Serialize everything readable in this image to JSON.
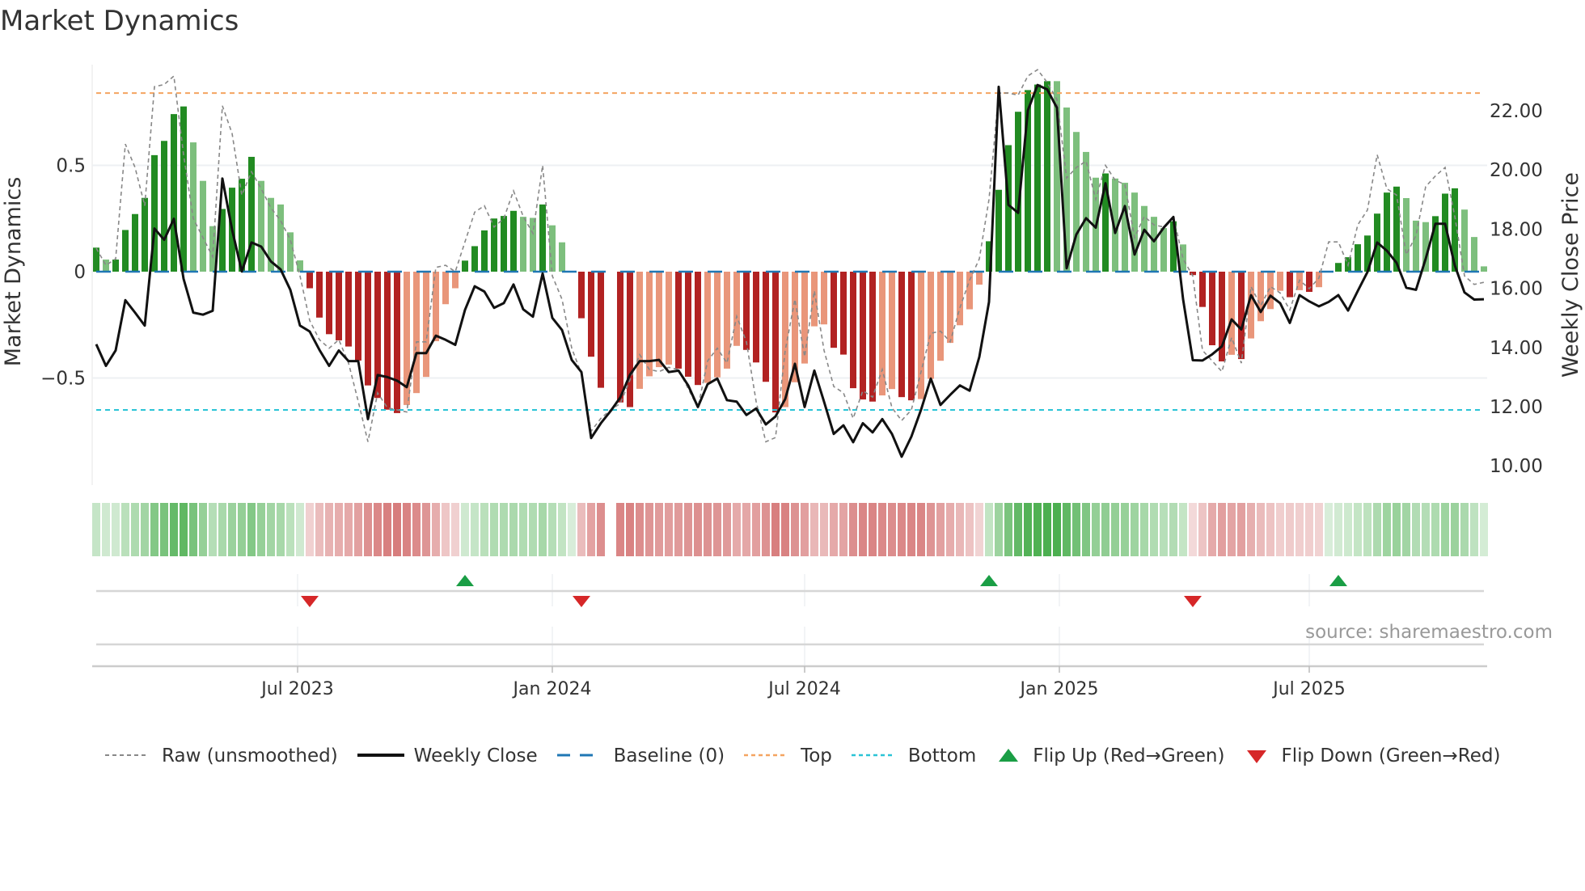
{
  "title": "Market Dynamics",
  "source": "source: sharemaestro.com",
  "chart_data": {
    "type": "bar",
    "title": "Market Dynamics",
    "ylabel_left": "Market Dynamics",
    "ylabel_right": "Weekly Close Price",
    "ylim_left": [
      -0.98,
      0.98
    ],
    "ylim_right": [
      10.0,
      23.6
    ],
    "left_ticks": [
      {
        "v": 0.5,
        "label": "0.5"
      },
      {
        "v": 0,
        "label": "0"
      },
      {
        "v": -0.5,
        "label": "−0.5"
      }
    ],
    "right_ticks": [
      {
        "v": 22,
        "label": "22.00"
      },
      {
        "v": 20,
        "label": "20.00"
      },
      {
        "v": 18,
        "label": "18.00"
      },
      {
        "v": 16,
        "label": "16.00"
      },
      {
        "v": 14,
        "label": "14.00"
      },
      {
        "v": 12,
        "label": "12.00"
      },
      {
        "v": 10,
        "label": "10.00"
      }
    ],
    "x_ticks": [
      {
        "week": 20.75,
        "label": "Jul 2023"
      },
      {
        "week": 47,
        "label": "Jan 2024"
      },
      {
        "week": 73,
        "label": "Jul 2024"
      },
      {
        "week": 99.25,
        "label": "Jan 2025"
      },
      {
        "week": 125,
        "label": "Jul 2025"
      }
    ],
    "top_level": 0.84,
    "bottom_level": -0.65,
    "baseline": 0,
    "bars": [
      0.113,
      0.057,
      0.057,
      0.196,
      0.271,
      0.347,
      0.548,
      0.615,
      0.741,
      0.777,
      0.608,
      0.427,
      0.214,
      0.295,
      0.395,
      0.437,
      0.54,
      0.427,
      0.347,
      0.316,
      0.185,
      0.053,
      -0.078,
      -0.216,
      -0.294,
      -0.323,
      -0.352,
      -0.418,
      -0.535,
      -0.594,
      -0.649,
      -0.665,
      -0.627,
      -0.571,
      -0.495,
      -0.327,
      -0.153,
      -0.078,
      0.052,
      0.12,
      0.194,
      0.25,
      0.262,
      0.286,
      0.258,
      0.253,
      0.316,
      0.218,
      0.138,
      0,
      -0.219,
      -0.4,
      -0.546,
      null,
      -0.615,
      -0.637,
      -0.551,
      -0.492,
      -0.449,
      -0.437,
      -0.456,
      -0.494,
      -0.533,
      -0.523,
      -0.497,
      -0.456,
      -0.349,
      -0.368,
      -0.427,
      -0.518,
      -0.662,
      -0.637,
      -0.52,
      -0.432,
      -0.257,
      -0.248,
      -0.358,
      -0.39,
      -0.548,
      -0.601,
      -0.611,
      -0.582,
      -0.552,
      -0.59,
      -0.605,
      -0.599,
      -0.504,
      -0.419,
      -0.335,
      -0.252,
      -0.177,
      -0.061,
      0.143,
      0.385,
      0.595,
      0.752,
      0.854,
      0.88,
      0.896,
      0.896,
      0.772,
      0.657,
      0.563,
      0.442,
      0.462,
      0.438,
      0.418,
      0.372,
      0.309,
      0.258,
      0.205,
      0.237,
      0.128,
      -0.016,
      -0.166,
      -0.346,
      -0.422,
      -0.391,
      -0.411,
      -0.314,
      -0.233,
      -0.176,
      -0.09,
      -0.12,
      -0.087,
      -0.095,
      -0.073,
      0,
      0.041,
      0.068,
      0.129,
      0.17,
      0.273,
      0.372,
      0.4,
      0.346,
      0.24,
      0.233,
      0.261,
      0.367,
      0.392,
      0.292,
      0.163,
      0.025
    ],
    "bar_strong": [
      1,
      0,
      1,
      1,
      1,
      1,
      1,
      1,
      1,
      1,
      0,
      0,
      0,
      1,
      1,
      1,
      1,
      0,
      0,
      0,
      0,
      0,
      1,
      1,
      1,
      1,
      1,
      1,
      1,
      1,
      1,
      1,
      0,
      0,
      0,
      0,
      0,
      0,
      1,
      1,
      1,
      1,
      1,
      1,
      0,
      0,
      1,
      0,
      0,
      0,
      1,
      1,
      1,
      0,
      1,
      1,
      0,
      0,
      0,
      0,
      1,
      1,
      1,
      0,
      0,
      0,
      0,
      1,
      1,
      1,
      1,
      0,
      0,
      0,
      0,
      0,
      1,
      1,
      1,
      1,
      1,
      0,
      0,
      1,
      1,
      0,
      0,
      0,
      0,
      0,
      0,
      0,
      1,
      1,
      1,
      1,
      1,
      1,
      1,
      0,
      0,
      0,
      0,
      0,
      1,
      0,
      0,
      0,
      0,
      0,
      0,
      1,
      0,
      1,
      1,
      1,
      1,
      0,
      1,
      0,
      0,
      0,
      0,
      1,
      0,
      1,
      0,
      0,
      1,
      1,
      1,
      1,
      1,
      1,
      1,
      0,
      0,
      0,
      1,
      1,
      1,
      0,
      0,
      0
    ],
    "weekly_close": [
      14.11,
      13.38,
      13.9,
      15.6,
      15.18,
      14.74,
      18.02,
      17.64,
      18.35,
      16.32,
      15.18,
      15.11,
      15.24,
      19.71,
      17.98,
      16.57,
      17.55,
      17.41,
      16.91,
      16.64,
      15.95,
      14.74,
      14.54,
      13.92,
      13.38,
      13.9,
      13.54,
      13.54,
      11.58,
      13.07,
      13.0,
      12.88,
      12.66,
      13.81,
      13.81,
      14.4,
      14.26,
      14.09,
      15.27,
      16.07,
      15.89,
      15.34,
      15.5,
      16.13,
      15.29,
      15.04,
      16.5,
      15.0,
      14.59,
      13.58,
      13.17,
      10.94,
      11.44,
      11.85,
      12.31,
      13.08,
      13.54,
      13.54,
      13.58,
      13.17,
      13.22,
      12.72,
      11.99,
      12.76,
      12.95,
      12.22,
      12.17,
      11.72,
      11.94,
      11.4,
      11.67,
      12.26,
      13.45,
      11.99,
      13.22,
      12.17,
      11.08,
      11.37,
      10.8,
      11.44,
      11.13,
      11.58,
      11.08,
      10.31,
      10.99,
      11.9,
      12.95,
      12.06,
      12.4,
      12.72,
      12.54,
      13.68,
      15.54,
      22.81,
      18.82,
      18.55,
      22.01,
      22.87,
      22.72,
      22.1,
      16.68,
      17.82,
      18.37,
      18.05,
      19.55,
      17.87,
      18.78,
      17.14,
      17.98,
      17.59,
      18.05,
      18.41,
      15.63,
      13.57,
      13.56,
      13.77,
      14.04,
      14.95,
      14.61,
      15.77,
      15.2,
      15.75,
      15.5,
      14.83,
      15.77,
      15.56,
      15.39,
      15.54,
      15.77,
      15.25,
      15.91,
      16.55,
      17.55,
      17.27,
      16.86,
      16.02,
      15.95,
      17.0,
      18.18,
      18.18,
      16.77,
      15.86,
      15.62,
      15.63
    ],
    "raw": [
      0.11,
      0.03,
      0.06,
      0.6,
      0.49,
      0.31,
      0.87,
      0.88,
      0.92,
      0.55,
      0.25,
      0.16,
      0.07,
      0.78,
      0.65,
      0.36,
      0.47,
      0.39,
      0.3,
      0.24,
      0.15,
      -0.02,
      -0.23,
      -0.32,
      -0.36,
      -0.32,
      -0.43,
      -0.61,
      -0.8,
      -0.57,
      -0.64,
      -0.65,
      -0.66,
      -0.33,
      -0.33,
      0.02,
      0.03,
      0,
      0.14,
      0.28,
      0.31,
      0.21,
      0.25,
      0.38,
      0.26,
      0.18,
      0.5,
      -0.02,
      -0.13,
      -0.36,
      -0.48,
      -0.75,
      -0.69,
      -0.65,
      -0.62,
      -0.51,
      -0.39,
      -0.46,
      -0.47,
      -0.45,
      -0.46,
      -0.55,
      -0.64,
      -0.42,
      -0.36,
      -0.43,
      -0.21,
      -0.33,
      -0.61,
      -0.8,
      -0.78,
      -0.37,
      -0.13,
      -0.4,
      -0.09,
      -0.37,
      -0.54,
      -0.57,
      -0.69,
      -0.56,
      -0.59,
      -0.46,
      -0.64,
      -0.7,
      -0.65,
      -0.47,
      -0.29,
      -0.28,
      -0.33,
      -0.17,
      -0.04,
      0.06,
      0.34,
      0.84,
      0.84,
      0.83,
      0.92,
      0.95,
      0.89,
      0.81,
      0.44,
      0.49,
      0.52,
      0.34,
      0.5,
      0.43,
      0.41,
      0.16,
      0.26,
      0.22,
      0.21,
      0.26,
      0.06,
      -0.02,
      -0.37,
      -0.42,
      -0.47,
      -0.31,
      -0.43,
      -0.07,
      -0.16,
      -0.07,
      -0.1,
      -0.18,
      -0.04,
      -0.08,
      -0.03,
      0.14,
      0.14,
      0.03,
      0.22,
      0.29,
      0.55,
      0.39,
      0.36,
      0.08,
      0.17,
      0.4,
      0.45,
      0.49,
      0.26,
      -0.02,
      -0.06,
      -0.05
    ],
    "flips_up": [
      38,
      92,
      128
    ],
    "flips_down": [
      22,
      50,
      113
    ],
    "legend": [
      {
        "key": "raw",
        "label": "Raw (unsmoothed)"
      },
      {
        "key": "close",
        "label": "Weekly Close"
      },
      {
        "key": "baseline",
        "label": "Baseline (0)"
      },
      {
        "key": "top",
        "label": "Top"
      },
      {
        "key": "bottom",
        "label": "Bottom"
      },
      {
        "key": "up",
        "label": "Flip Up (Red→Green)"
      },
      {
        "key": "down",
        "label": "Flip Down (Green→Red)"
      }
    ],
    "legend_position": "bottom",
    "colors": {
      "pos_strong": "#228b22",
      "pos_weak": "#7dbf7d",
      "neg_strong": "#b22222",
      "neg_weak": "#e9967a",
      "close": "#111111",
      "raw": "#888888",
      "baseline": "#1f77b4",
      "top": "#f4a460",
      "bottom": "#2bc4d6",
      "flip_up": "#1a9e45",
      "flip_down": "#d62728",
      "heat_pos": "#4caf50",
      "heat_neg": "#cd5c5c"
    }
  }
}
